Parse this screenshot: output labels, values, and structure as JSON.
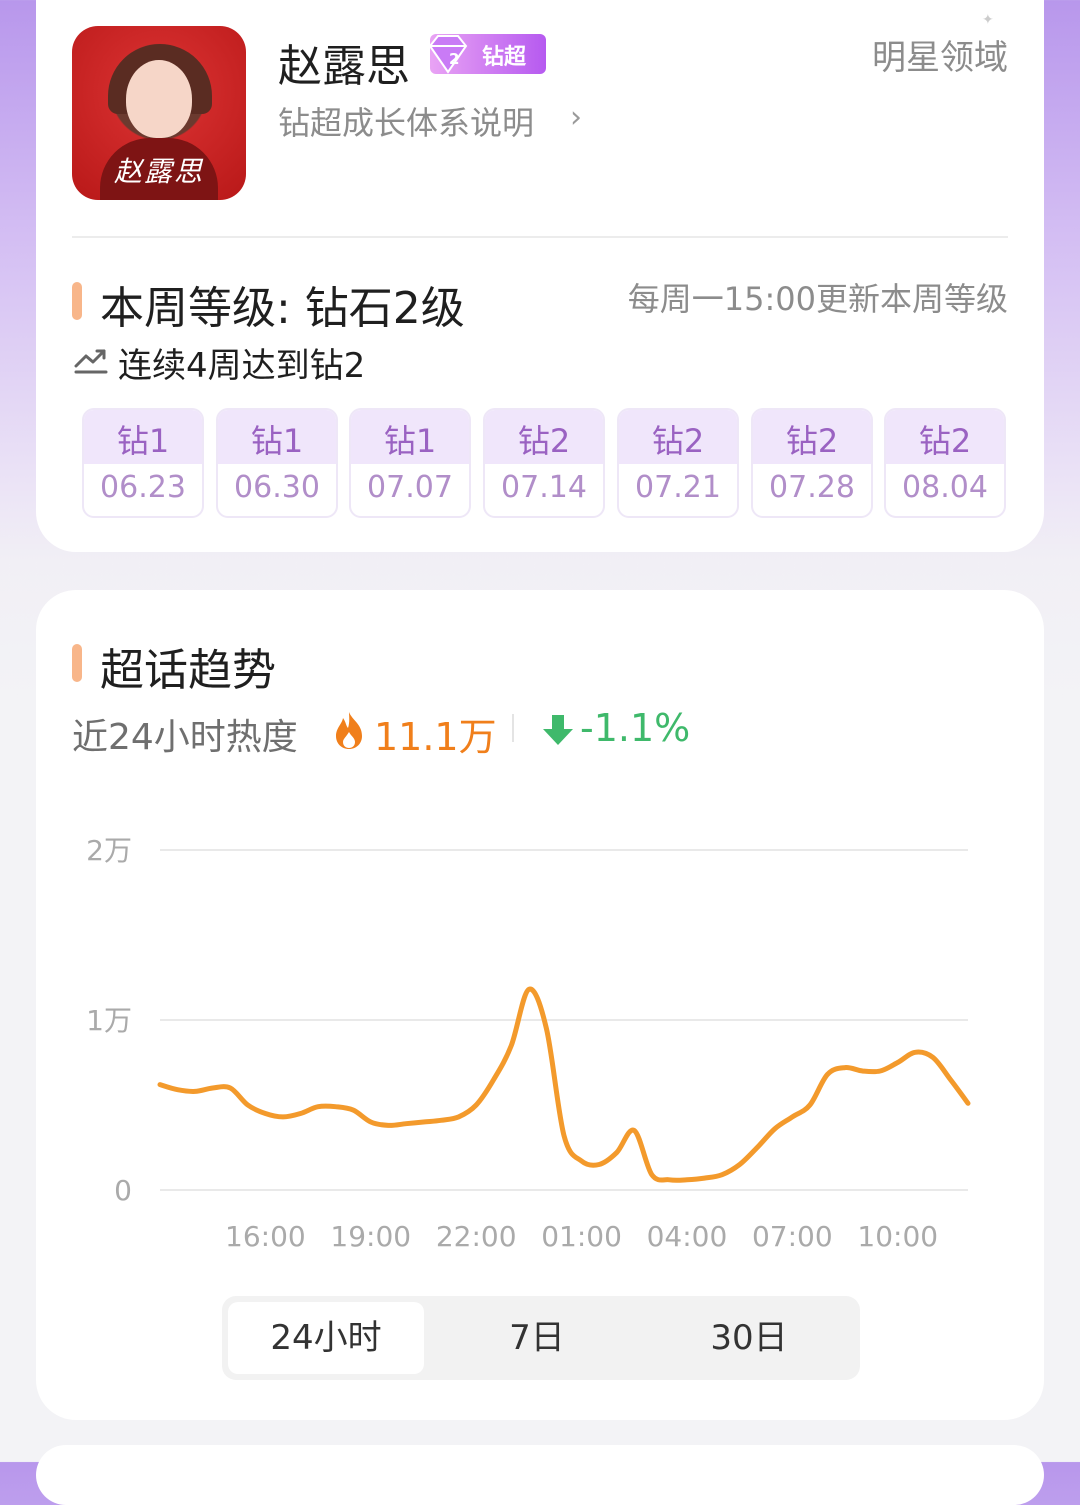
{
  "profile": {
    "avatar_caption": "赵露思",
    "name": "赵露思",
    "badge_level": "2",
    "badge_label": "钻超",
    "growth_link": "钻超成长体系说明",
    "star_domain": "明星领域"
  },
  "level": {
    "title": "本周等级: 钻石2级",
    "update_note": "每周一15:00更新本周等级",
    "streak": "连续4周达到钻2",
    "weeks": [
      {
        "level": "钻1",
        "date": "06.23"
      },
      {
        "level": "钻1",
        "date": "06.30"
      },
      {
        "level": "钻1",
        "date": "07.07"
      },
      {
        "level": "钻2",
        "date": "07.14"
      },
      {
        "level": "钻2",
        "date": "07.21"
      },
      {
        "level": "钻2",
        "date": "07.28"
      },
      {
        "level": "钻2",
        "date": "08.04"
      }
    ]
  },
  "trend": {
    "title": "超话趋势",
    "heat_label": "近24小时热度",
    "heat_value": "11.1万",
    "change_value": "-1.1%",
    "tabs": [
      "24小时",
      "7日",
      "30日"
    ],
    "active_tab": 0
  },
  "colors": {
    "accent": "#f39a2c",
    "heat": "#f07f1b",
    "down": "#3fb96b",
    "badge": "#b65af0",
    "section_bar": "#f8b68a"
  },
  "icons": {
    "streak": "trend-up-icon",
    "heat": "flame-icon",
    "change": "arrow-down-icon",
    "growth": "chevron-right-icon"
  },
  "chart_data": {
    "type": "line",
    "ylim": [
      0,
      20000
    ],
    "ytick_labels": [
      "2万",
      "1万",
      "0"
    ],
    "yticks": [
      20000,
      10000,
      0
    ],
    "xtick_labels": [
      "16:00",
      "19:00",
      "22:00",
      "01:00",
      "04:00",
      "07:00",
      "10:00"
    ],
    "xticks_hours": [
      3,
      6,
      9,
      12,
      15,
      18,
      21
    ],
    "grid": true,
    "x_hours": [
      0,
      0.5,
      1,
      1.5,
      2,
      2.5,
      3,
      3.5,
      4,
      4.5,
      5,
      5.5,
      6,
      6.5,
      7,
      7.5,
      8,
      8.5,
      9,
      9.5,
      10,
      10.5,
      11,
      11.5,
      12,
      12.5,
      13,
      13.5,
      14,
      14.5,
      15,
      15.5,
      16,
      16.5,
      17,
      17.5,
      18,
      18.5,
      19,
      19.5,
      20,
      20.5,
      21,
      21.5,
      22,
      22.5,
      23
    ],
    "values": [
      6200,
      5900,
      5800,
      6000,
      6000,
      5000,
      4500,
      4300,
      4500,
      4900,
      4900,
      4700,
      4000,
      3800,
      3900,
      4000,
      4100,
      4300,
      5000,
      6500,
      8500,
      11800,
      9500,
      3200,
      1700,
      1500,
      2200,
      3500,
      900,
      600,
      600,
      700,
      900,
      1500,
      2500,
      3600,
      4300,
      5000,
      6800,
      7200,
      7000,
      7000,
      7500,
      8100,
      7800,
      6500,
      5100
    ]
  }
}
